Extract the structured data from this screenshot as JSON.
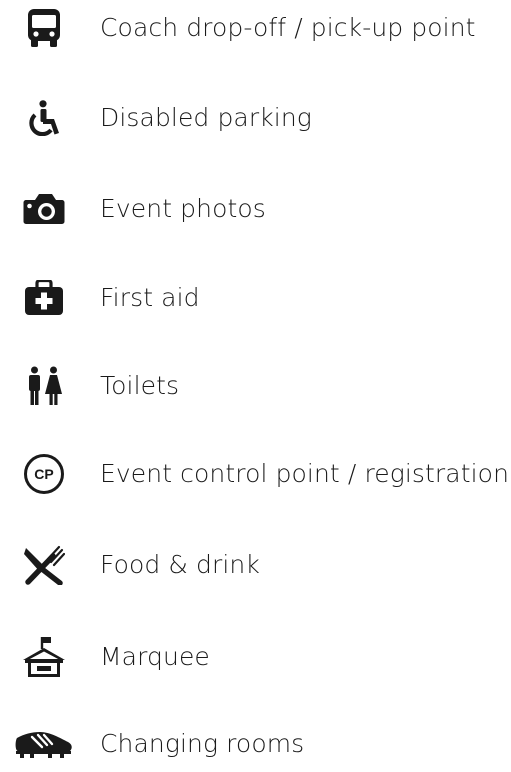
{
  "legend": {
    "items": [
      {
        "icon": "bus-icon",
        "label": "Coach drop-off / pick-up point"
      },
      {
        "icon": "wheelchair-icon",
        "label": "Disabled parking"
      },
      {
        "icon": "camera-icon",
        "label": "Event photos"
      },
      {
        "icon": "first-aid-kit-icon",
        "label": "First aid"
      },
      {
        "icon": "toilets-icon",
        "label": "Toilets"
      },
      {
        "icon": "control-point-icon",
        "label": "Event control point / registration",
        "badge": "CP"
      },
      {
        "icon": "fork-knife-icon",
        "label": "Food & drink"
      },
      {
        "icon": "marquee-icon",
        "label": "Marquee"
      },
      {
        "icon": "football-boot-icon",
        "label": "Changing rooms"
      }
    ]
  },
  "colors": {
    "icon": "#1a1a1a",
    "text": "#1a1a1a",
    "background": "#ffffff"
  }
}
